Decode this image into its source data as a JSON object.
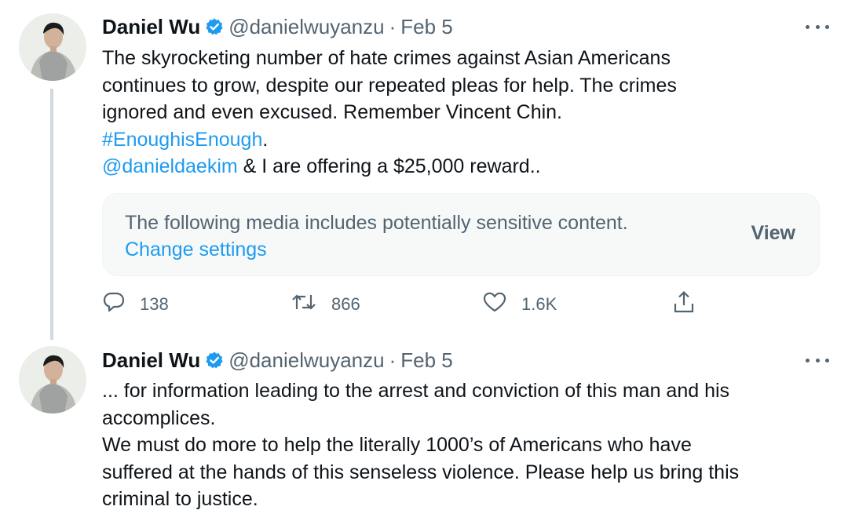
{
  "tweets": [
    {
      "author_name": "Daniel Wu",
      "handle": "@danielwuyanzu",
      "separator": "·",
      "date": "Feb 5",
      "text_lines": [
        "The skyrocketing number of hate crimes against Asian Americans",
        "continues to grow, despite our repeated pleas for help. The crimes",
        "ignored and even excused. Remember Vincent Chin."
      ],
      "hashtag": "#EnoughisEnough",
      "hashtag_suffix": ".",
      "mention": "@danieldaekim",
      "mention_suffix": " & I are offering a $25,000 reward..",
      "sensitive_media": {
        "message": "The following media includes potentially sensitive content.",
        "settings_link": "Change settings",
        "view_button": "View"
      },
      "actions": {
        "replies": "138",
        "retweets": "866",
        "likes": "1.6K"
      }
    },
    {
      "author_name": "Daniel Wu",
      "handle": "@danielwuyanzu",
      "separator": "·",
      "date": "Feb 5",
      "text_lines": [
        "... for information leading to the arrest and conviction of this man and his",
        "accomplices.",
        "We must do more to help the literally 1000’s of Americans who have",
        "suffered at the hands of this senseless violence. Please help us bring this",
        "criminal to justice."
      ]
    }
  ],
  "colors": {
    "accent": "#1d9bf0",
    "secondary_text": "#536471",
    "primary_text": "#0f1419",
    "thread_line": "#cfd9de",
    "media_box_bg": "#f7f9f9"
  },
  "icons": [
    "verified-badge-icon",
    "more-icon",
    "reply-icon",
    "retweet-icon",
    "like-icon",
    "share-icon"
  ]
}
